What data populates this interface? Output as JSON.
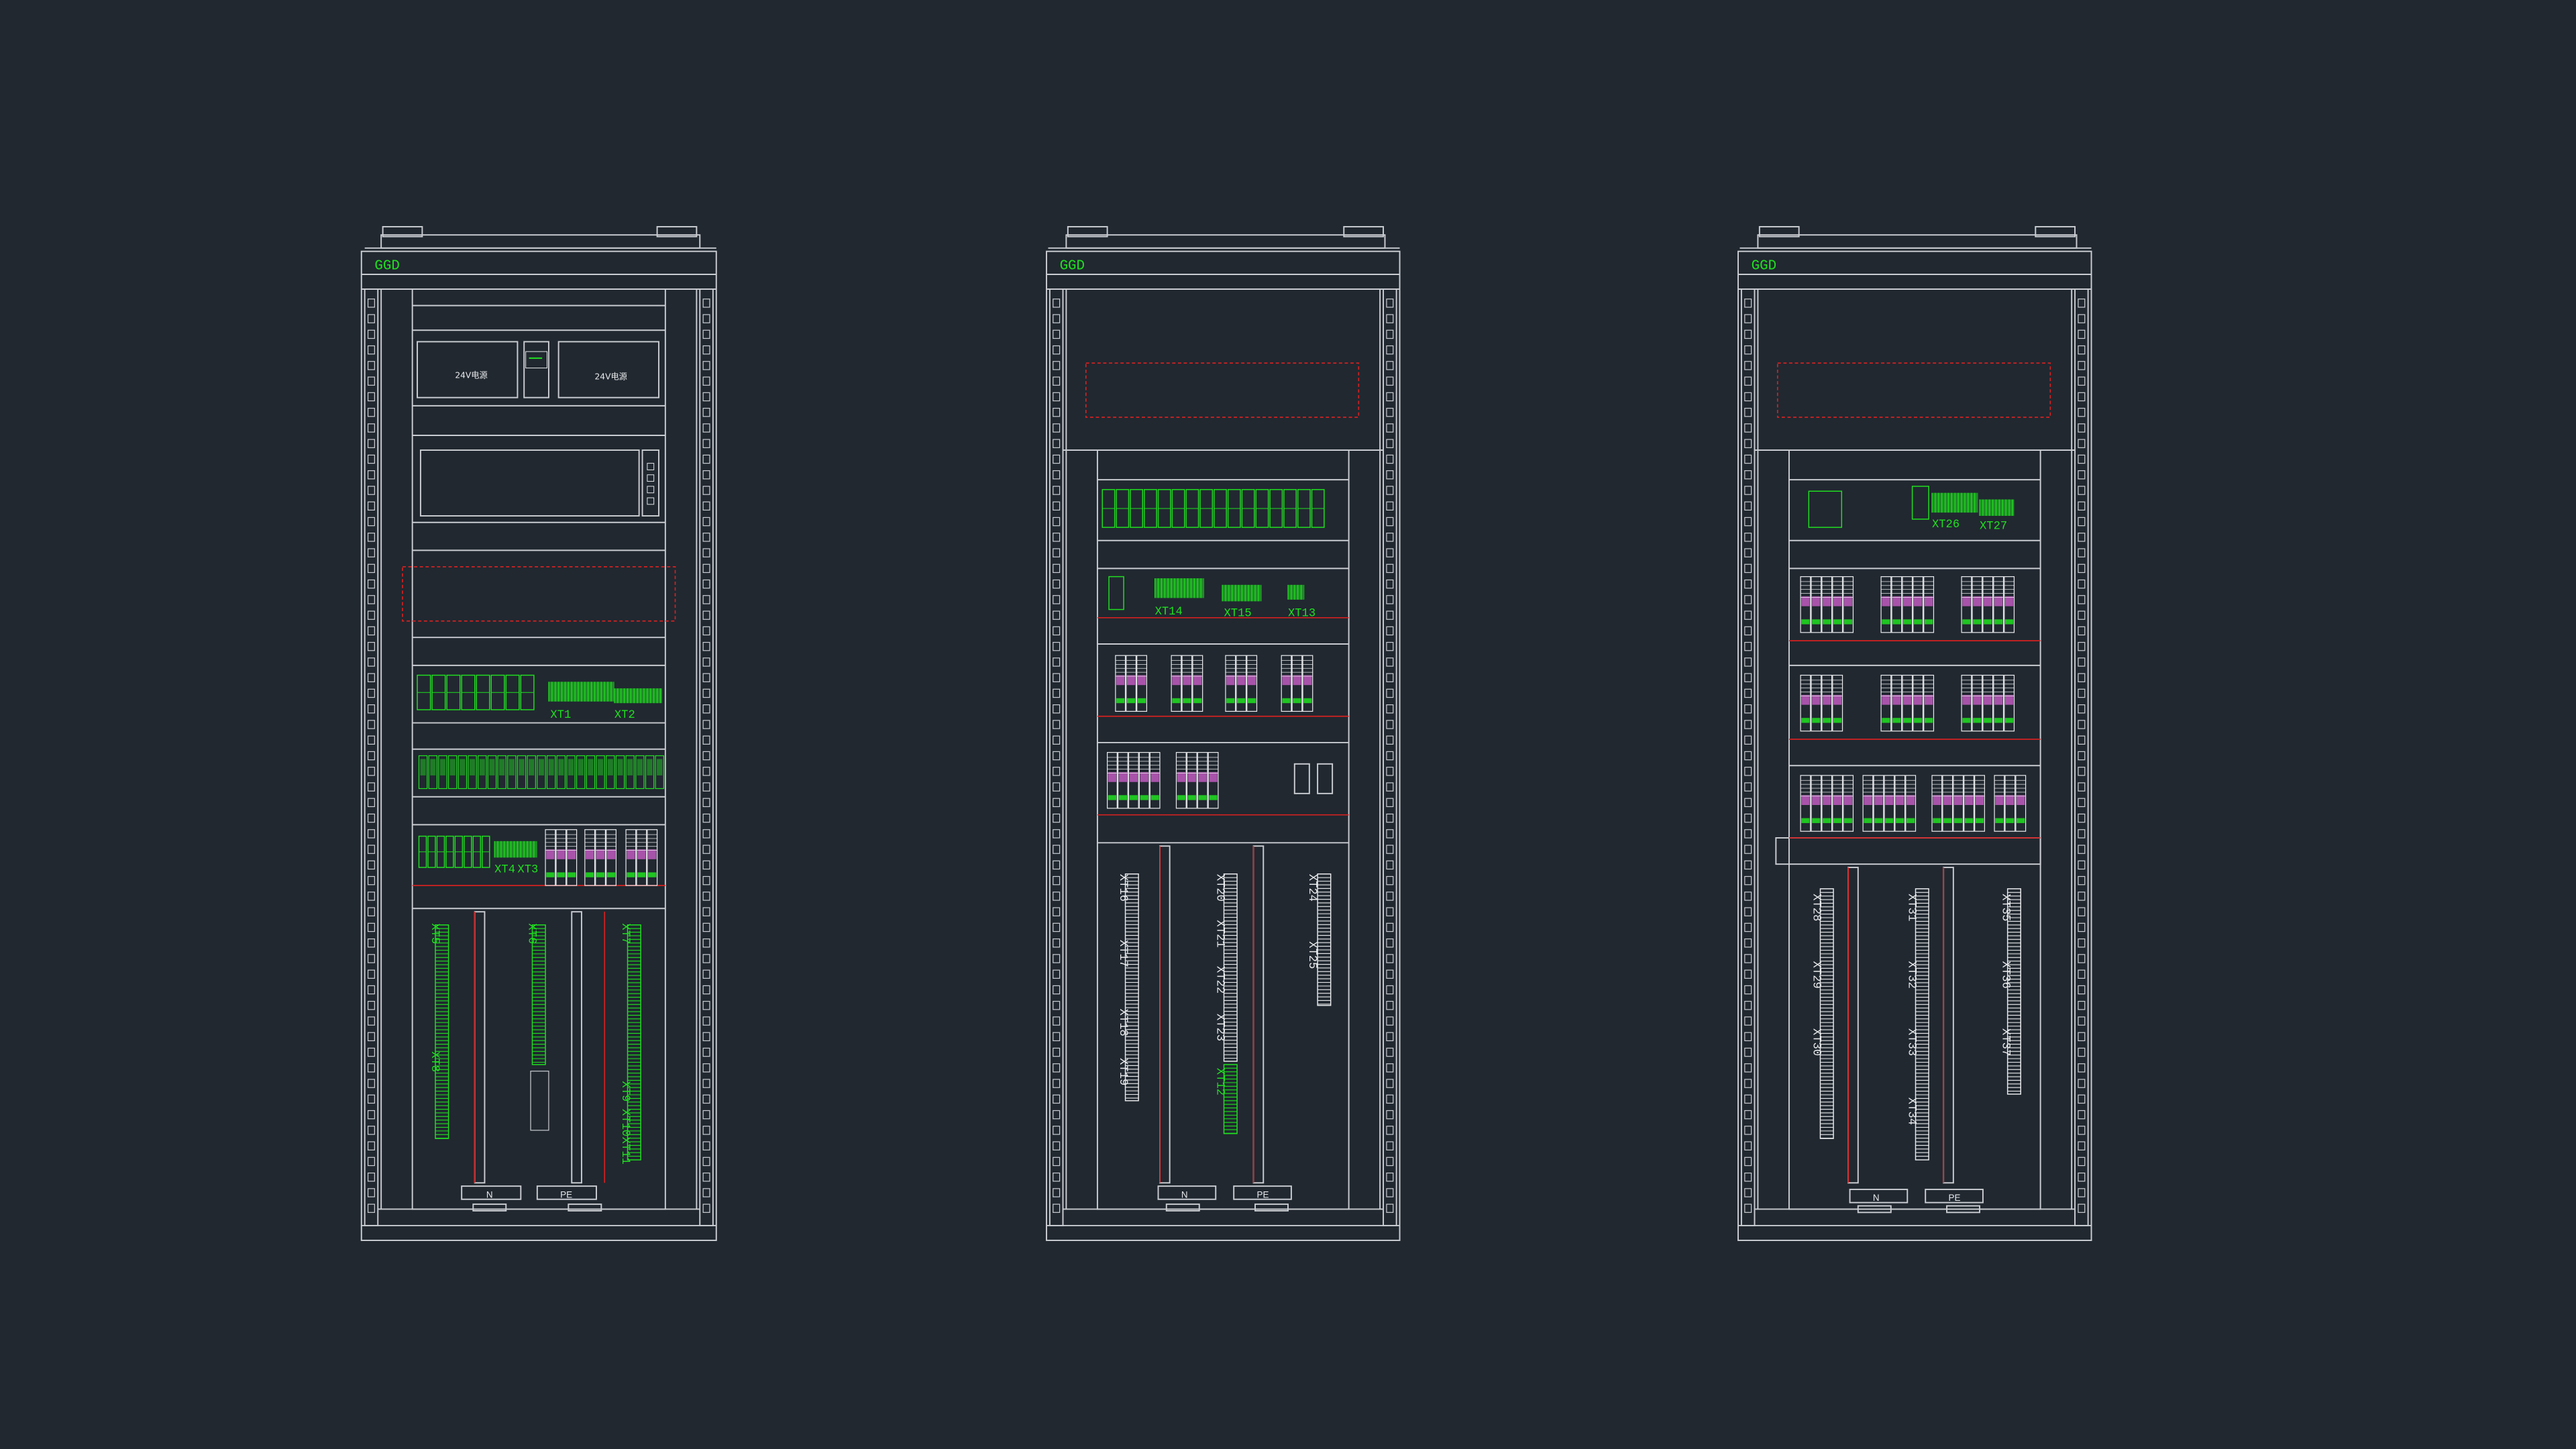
{
  "colors": {
    "background": "#212830",
    "frame": "#c9ccd1",
    "accent": "#20e020",
    "red": "#d52121",
    "magenta": "#c05bc0",
    "white": "#e8eaec"
  },
  "cabinets": [
    {
      "id": "cabinet-1",
      "brand": "GGD",
      "bus_labels": [
        "N",
        "PE"
      ],
      "psu_labels": [
        "24V电源",
        "24V电源"
      ],
      "terminal_labels_top": [
        "XT1",
        "XT2"
      ],
      "terminal_labels_row3": [
        "XT4",
        "XT3"
      ],
      "vertical_labels": [
        "XT5",
        "XT6",
        "XT7",
        "XT8",
        "XT9",
        "XT10",
        "XT11"
      ]
    },
    {
      "id": "cabinet-2",
      "brand": "GGD",
      "bus_labels": [
        "N",
        "PE"
      ],
      "terminal_labels_top": [
        "XT14",
        "XT15",
        "XT13"
      ],
      "vertical_labels": [
        "XT16",
        "XT17",
        "XT18",
        "XT19",
        "XT20",
        "XT21",
        "XT22",
        "XT23",
        "XT12",
        "XT24",
        "XT25"
      ]
    },
    {
      "id": "cabinet-3",
      "brand": "GGD",
      "bus_labels": [
        "N",
        "PE"
      ],
      "terminal_labels_top": [
        "XT26",
        "XT27"
      ],
      "vertical_labels": [
        "XT28",
        "XT29",
        "XT30",
        "XT31",
        "XT32",
        "XT33",
        "XT34",
        "XT35",
        "XT36",
        "XT37"
      ]
    }
  ]
}
